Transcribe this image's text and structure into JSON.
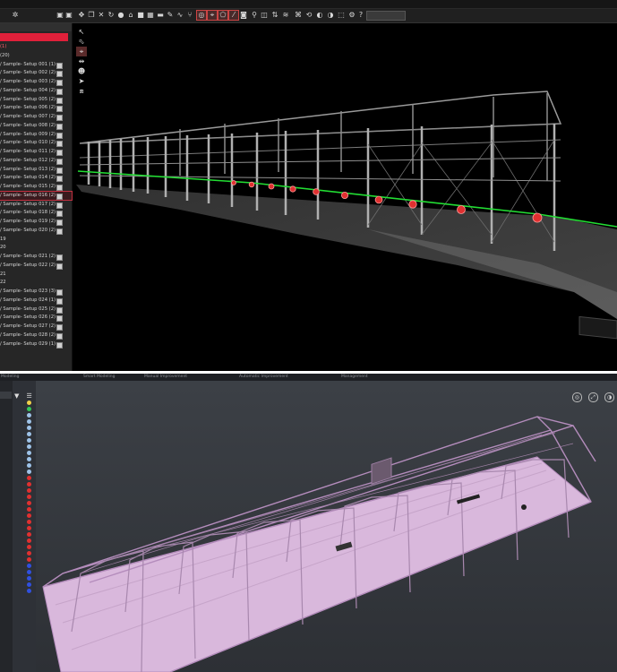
{
  "top_app": {
    "title_tabs": [
      "",
      "",
      ""
    ],
    "toolbar_select_value": "",
    "panel_header": "",
    "red_button_label": "",
    "tree": [
      {
        "label": "(1)",
        "type": "header"
      },
      {
        "label": "(20)",
        "type": "group"
      },
      {
        "label": "/ Sample- Setup 001 (1)"
      },
      {
        "label": "/ Sample- Setup 002 (2)"
      },
      {
        "label": "/ Sample- Setup 003 (2)"
      },
      {
        "label": "/ Sample- Setup 004 (2)"
      },
      {
        "label": "/ Sample- Setup 005 (2)"
      },
      {
        "label": "/ Sample- Setup 006 (2)"
      },
      {
        "label": "/ Sample- Setup 007 (2)"
      },
      {
        "label": "/ Sample- Setup 008 (2)"
      },
      {
        "label": "/ Sample- Setup 009 (2)"
      },
      {
        "label": "/ Sample- Setup 010 (2)"
      },
      {
        "label": "/ Sample- Setup 011 (2)"
      },
      {
        "label": "/ Sample- Setup 012 (2)"
      },
      {
        "label": "/ Sample- Setup 013 (2)"
      },
      {
        "label": "/ Sample- Setup 014 (2)"
      },
      {
        "label": "/ Sample- Setup 015 (2)"
      },
      {
        "label": "/ Sample- Setup 016 (2)",
        "highlight": true
      },
      {
        "label": "/ Sample- Setup 017 (2)"
      },
      {
        "label": "/ Sample- Setup 018 (2)"
      },
      {
        "label": "/ Sample- Setup 019 (2)"
      },
      {
        "label": "/ Sample- Setup 020 (2)"
      },
      {
        "label": "19",
        "type": "group"
      },
      {
        "label": "20",
        "type": "group"
      },
      {
        "label": "/ Sample- Setup 021 (2)"
      },
      {
        "label": "/ Sample- Setup 022 (2)"
      },
      {
        "label": "21",
        "type": "group"
      },
      {
        "label": "22",
        "type": "group"
      },
      {
        "label": "/ Sample- Setup 023 (3)"
      },
      {
        "label": "/ Sample- Setup 024 (1)"
      },
      {
        "label": "/ Sample- Setup 025 (2)"
      },
      {
        "label": "/ Sample- Setup 026 (2)"
      },
      {
        "label": "/ Sample- Setup 027 (2)"
      },
      {
        "label": "/ Sample- Setup 028 (2)"
      },
      {
        "label": "/ Sample- Setup 029 (1)"
      }
    ],
    "view_tools": [
      "arrow-icon",
      "lasso-icon",
      "target-icon",
      "measure-icon",
      "person-icon",
      "navigate-icon",
      "cube-icon"
    ],
    "colors": {
      "accent_red": "#e0203a",
      "scan_line": "#22dd33",
      "marker": "#e03030"
    }
  },
  "bottom_app": {
    "menu_tabs": [
      "Modeling",
      "Smart Modeling",
      "Manual Improvement",
      "Automatic Improvement",
      "Management"
    ],
    "colors": {
      "floor": "#d9b8dc",
      "frame": "#b48cbc",
      "background": "#2e3137"
    },
    "dot_colors": [
      "#f1d04a",
      "#34c759",
      "#9ec3e8",
      "#9ec3e8",
      "#9ec3e8",
      "#9ec3e8",
      "#9ec3e8",
      "#9ec3e8",
      "#9ec3e8",
      "#9ec3e8",
      "#9ec3e8",
      "#9ec3e8",
      "#e03030",
      "#e03030",
      "#e03030",
      "#e03030",
      "#e03030",
      "#e03030",
      "#e03030",
      "#e03030",
      "#e03030",
      "#e03030",
      "#e03030",
      "#e03030",
      "#e03030",
      "#e03030",
      "#3050e0",
      "#3050e0",
      "#3050e0",
      "#3050e0",
      "#3050e0"
    ]
  }
}
